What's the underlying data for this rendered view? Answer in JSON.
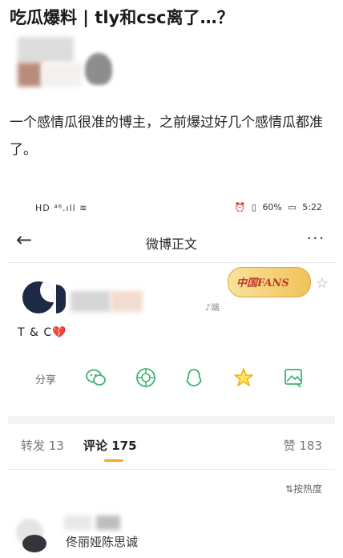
{
  "article": {
    "title": "吃瓜爆料 | tly和csc离了…？",
    "body": "一个感情瓜很准的博主，之前爆过好几个感情瓜都准了。"
  },
  "status_bar": {
    "left": "HD ⁴⁶.ıll ≋",
    "alarm": "⏰",
    "vibrate": "▯",
    "battery": "60%",
    "battery_icon": "▭",
    "time": "5:22"
  },
  "nav": {
    "back_icon": "arrow-left-icon",
    "back_glyph": "←",
    "title": "微博正文",
    "more": "···"
  },
  "post": {
    "badge_text": "中国FANS",
    "source": "♪端",
    "text": "T & C",
    "heart": "💔",
    "star_glyph": "☆"
  },
  "share": {
    "label": "分享",
    "icons": [
      "wechat-icon",
      "moments-icon",
      "qq-icon",
      "star-icon",
      "image-icon"
    ]
  },
  "tabs": {
    "repost": "转发 13",
    "comments": "评论 175",
    "likes": "赞 183"
  },
  "sort": {
    "label": "按热度",
    "glyph": "⇅"
  },
  "comment": {
    "author": "佟丽娅陈思诚"
  },
  "colors": {
    "accent": "#f5a623",
    "share_green": "#3cb371",
    "share_yellow": "#f0b400",
    "heart_red": "#d0344d"
  }
}
